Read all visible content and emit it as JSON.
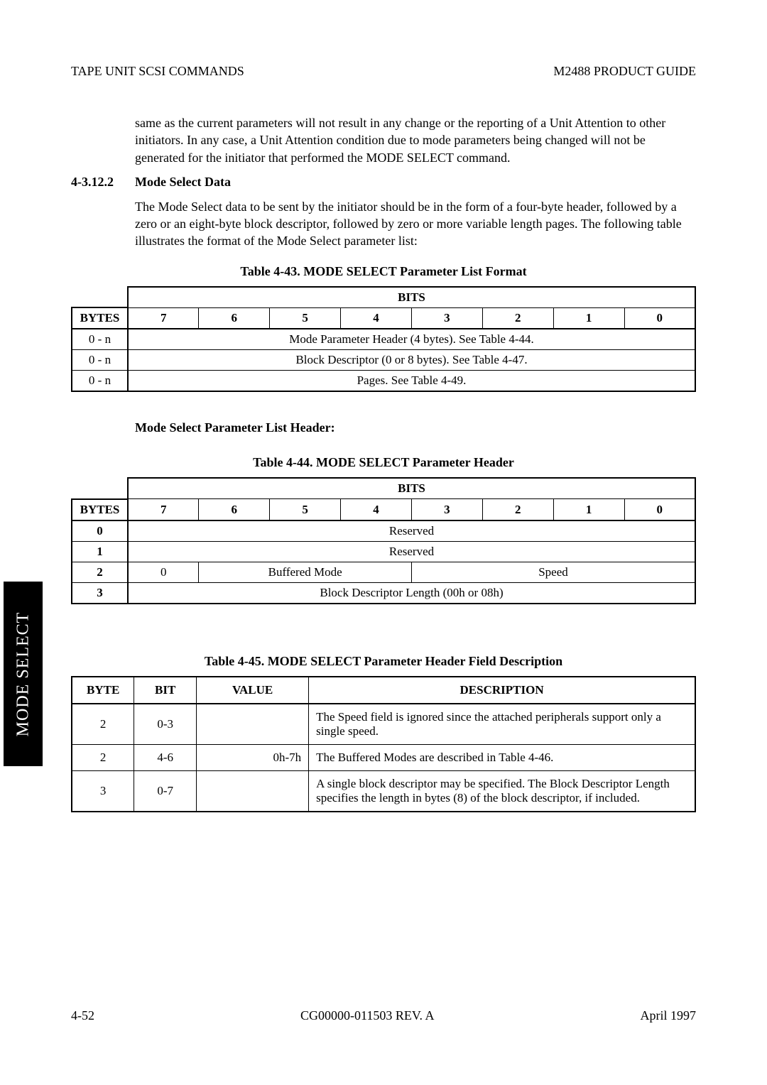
{
  "header": {
    "left": "TAPE UNIT SCSI COMMANDS",
    "right": "M2488 PRODUCT GUIDE"
  },
  "intro_para": "same as the current parameters will not result in any change or the reporting of a Unit Attention to other initiators. In any case, a Unit Attention condition due to mode parameters being changed will not be generated for the initiator that performed the MODE SELECT command.",
  "section": {
    "num": "4-3.12.2",
    "title": "Mode Select Data"
  },
  "section_para": "The Mode Select data to be sent by the initiator should be in the form of a four-byte header, followed by a zero or an eight-byte block descriptor, followed by zero or more variable length pages. The following table illustrates the format of the Mode Select parameter list:",
  "t43": {
    "caption": "Table 4-43.   MODE SELECT Parameter List Format",
    "bits_label": "BITS",
    "bytes_label": "BYTES",
    "bit_headers": [
      "7",
      "6",
      "5",
      "4",
      "3",
      "2",
      "1",
      "0"
    ],
    "rows": [
      {
        "byte": "0 - n",
        "cell": "Mode Parameter Header (4 bytes). See Table 4-44."
      },
      {
        "byte": "0 - n",
        "cell": "Block Descriptor (0 or 8 bytes). See Table 4-47."
      },
      {
        "byte": "0 - n",
        "cell": "Pages. See Table 4-49."
      }
    ]
  },
  "subheader": "Mode Select Parameter List Header",
  "t44": {
    "caption": "Table 4-44.   MODE SELECT Parameter Header",
    "bits_label": "BITS",
    "bytes_label": "BYTES",
    "bit_headers": [
      "7",
      "6",
      "5",
      "4",
      "3",
      "2",
      "1",
      "0"
    ],
    "rows": {
      "r0": {
        "byte": "0",
        "cell": "Reserved"
      },
      "r1": {
        "byte": "1",
        "cell": "Reserved"
      },
      "r2": {
        "byte": "2",
        "c0": "0",
        "buffered": "Buffered Mode",
        "speed": "Speed"
      },
      "r3": {
        "byte": "3",
        "cell": "Block Descriptor Length (00h or 08h)"
      }
    }
  },
  "t45": {
    "caption": "Table 4-45.   MODE SELECT Parameter Header Field Description",
    "headers": {
      "byte": "BYTE",
      "bit": "BIT",
      "value": "VALUE",
      "desc": "DESCRIPTION"
    },
    "rows": [
      {
        "byte": "2",
        "bit": "0-3",
        "value": "",
        "desc": "The Speed field is ignored since the attached peripherals support only a single speed."
      },
      {
        "byte": "2",
        "bit": "4-6",
        "value": "0h-7h",
        "desc": "The Buffered Modes are described in Table 4-46."
      },
      {
        "byte": "3",
        "bit": "0-7",
        "value": "",
        "desc": "A single block descriptor may be specified. The Block Descriptor Length specifies the length in bytes (8) of the block descriptor, if included."
      }
    ]
  },
  "side_tab": "MODE SELECT",
  "footer": {
    "left": "4-52",
    "center": "CG00000-011503 REV. A",
    "right": "April 1997"
  }
}
